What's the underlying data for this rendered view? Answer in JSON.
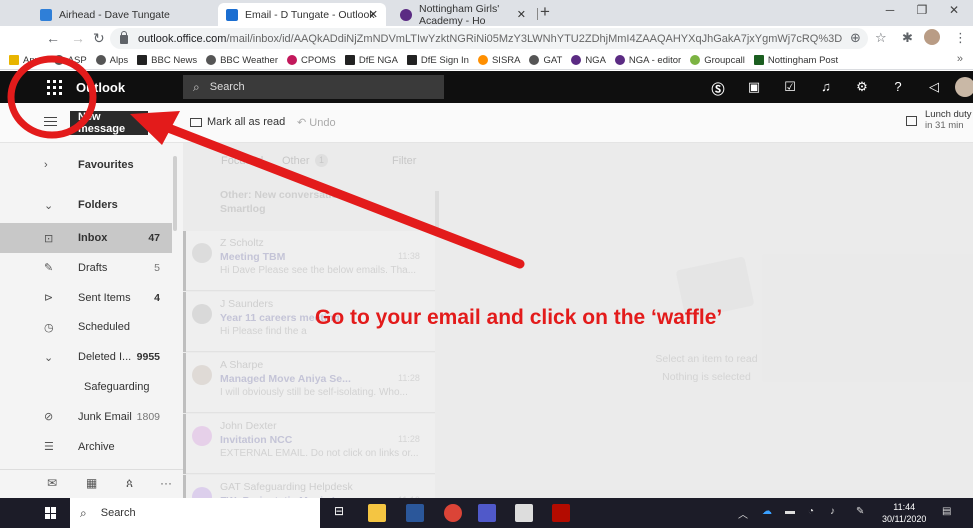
{
  "browser": {
    "tabs": [
      {
        "title": "Airhead - Dave Tungate",
        "active": false,
        "color": "#2f7fd8"
      },
      {
        "title": "Email - D Tungate - Outlook",
        "active": true,
        "color": "#1b6ed1"
      },
      {
        "title": "Nottingham Girls' Academy - Ho",
        "active": false,
        "color": "#5b2b83"
      }
    ],
    "url_host": "outlook.office.com",
    "url_path": "/mail/inbox/id/AAQkADdiNjZmNDVmLTIwYzktNGRiNi05MzY3LWNhYTU2ZDhjMmI4ZAAQAHYXqJhGakA7jxYgmWj7cRQ%3D",
    "bookmarks": [
      {
        "label": "Apps",
        "color": "#e8b400"
      },
      {
        "label": "ASP",
        "color": "#555555"
      },
      {
        "label": "Alps",
        "color": "#555555"
      },
      {
        "label": "BBC News",
        "color": "#222222"
      },
      {
        "label": "BBC Weather",
        "color": "#555555"
      },
      {
        "label": "CPOMS",
        "color": "#c2185b"
      },
      {
        "label": "DfE NGA",
        "color": "#222222"
      },
      {
        "label": "DfE Sign In",
        "color": "#222222"
      },
      {
        "label": "SISRA",
        "color": "#ff8f00"
      },
      {
        "label": "GAT",
        "color": "#555555"
      },
      {
        "label": "NGA",
        "color": "#5b2b83"
      },
      {
        "label": "NGA - editor",
        "color": "#5b2b83"
      },
      {
        "label": "Groupcall",
        "color": "#7cb342"
      },
      {
        "label": "Nottingham Post",
        "color": "#1b5e20"
      }
    ]
  },
  "outlook": {
    "brand": "Outlook",
    "search_placeholder": "Search",
    "new_message": "New message",
    "mark_all_read": "Mark all as read",
    "undo": "Undo",
    "reminder_title": "Lunch duty",
    "reminder_sub": "in 31 min",
    "focused_tab": "Focused",
    "other_tab": "Other",
    "other_count": "1",
    "filter": "Filter",
    "other_banner_1": "Other: New conversatio",
    "other_banner_2": "Smartlog"
  },
  "folders": [
    {
      "label": "Favourites",
      "count": "",
      "icon": "chevron-right-icon"
    },
    {
      "label": "Folders",
      "count": "",
      "icon": "chevron-down-icon"
    },
    {
      "label": "Inbox",
      "count": "47",
      "icon": "inbox-icon"
    },
    {
      "label": "Drafts",
      "count": "5",
      "icon": "pencil-icon"
    },
    {
      "label": "Sent Items",
      "count": "4",
      "icon": "send-icon"
    },
    {
      "label": "Scheduled",
      "count": "",
      "icon": "clock-icon"
    },
    {
      "label": "Deleted I...",
      "count": "9955",
      "icon": "chevron-down-icon"
    },
    {
      "label": "Safeguarding",
      "count": "",
      "icon": ""
    },
    {
      "label": "Junk Email",
      "count": "1809",
      "icon": "block-icon"
    },
    {
      "label": "Archive",
      "count": "",
      "icon": "archive-icon"
    }
  ],
  "messages": [
    {
      "from": "Z Scholtz",
      "subject": "Meeting TBM",
      "time": "11:38",
      "preview": "Hi Dave Please see the below emails. Tha...",
      "avatar_color": "#d9d9d9"
    },
    {
      "from": "J Saunders",
      "subject": "Year 11 careers meeting",
      "time": "",
      "preview": "Hi Please find the a",
      "avatar_color": "#d4d4d4"
    },
    {
      "from": "A Sharpe",
      "subject": "Managed Move Aniya Se...",
      "time": "11:28",
      "preview": "I will obviously still be self-isolating. Who...",
      "avatar_color": "#dcd6d0"
    },
    {
      "from": "John Dexter",
      "subject": "Invitation NCC",
      "time": "11:28",
      "preview": "EXTERNAL EMAIL. Do not click on links or...",
      "avatar_color": "#e6c9ea"
    },
    {
      "from": "GAT Safeguarding Helpdesk",
      "subject": "FW: Peripatetic Music Le...",
      "time": "11:10",
      "preview": "",
      "avatar_color": "#d9c7ee"
    }
  ],
  "reading": {
    "line1": "Select an item to read",
    "line2": "Nothing is selected"
  },
  "annotation": {
    "text": "Go to your email and click on the ‘waffle’",
    "color": "#e31b1b"
  },
  "taskbar": {
    "search": "Search",
    "time": "11:44",
    "date": "30/11/2020"
  }
}
